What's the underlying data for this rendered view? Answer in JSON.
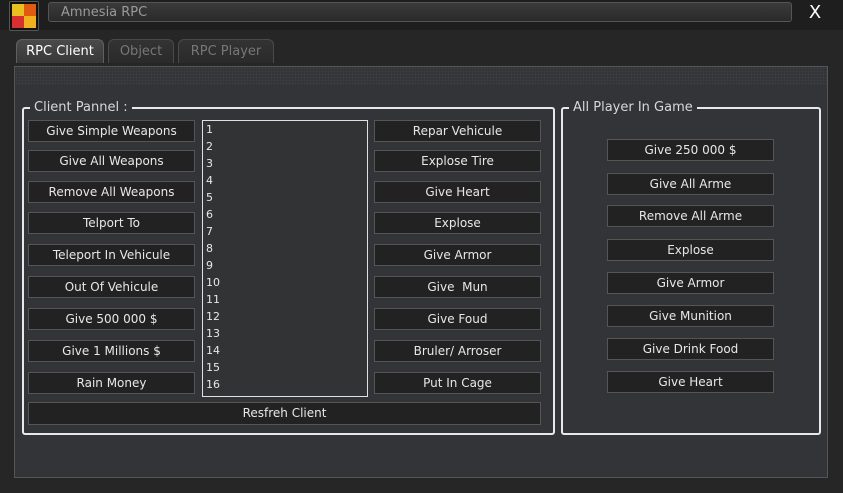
{
  "window": {
    "title": "Amnesia RPC",
    "close_label": "X"
  },
  "tabs": [
    {
      "label": "RPC Client",
      "active": true
    },
    {
      "label": "Object",
      "active": false
    },
    {
      "label": "RPC Player",
      "active": false
    }
  ],
  "client_panel": {
    "legend": "Client Pannel :",
    "left_buttons": [
      "Give Simple Weapons",
      "Give All Weapons",
      "Remove All Weapons",
      "Telport To",
      "Teleport In Vehicule",
      "Out Of Vehicule",
      "Give 500 000 $",
      "Give 1 Millions $",
      "Rain Money"
    ],
    "clients_list": [
      "1",
      "2",
      "3",
      "4",
      "5",
      "6",
      "7",
      "8",
      "9",
      "10",
      "11",
      "12",
      "13",
      "14",
      "15",
      "16"
    ],
    "right_buttons": [
      "Repar Vehicule",
      "Explose Tire",
      "Give Heart",
      "Explose",
      "Give Armor",
      "Give  Mun",
      "Give Foud",
      "Bruler/ Arroser",
      "Put In Cage"
    ],
    "refresh_label": "Resfreh Client"
  },
  "all_player": {
    "legend": "All Player In Game",
    "buttons": [
      "Give 250 000 $",
      "Give All Arme",
      "Remove All Arme",
      "Explose",
      "Give Armor",
      "Give Munition",
      "Give Drink Food",
      "Give Heart"
    ]
  }
}
